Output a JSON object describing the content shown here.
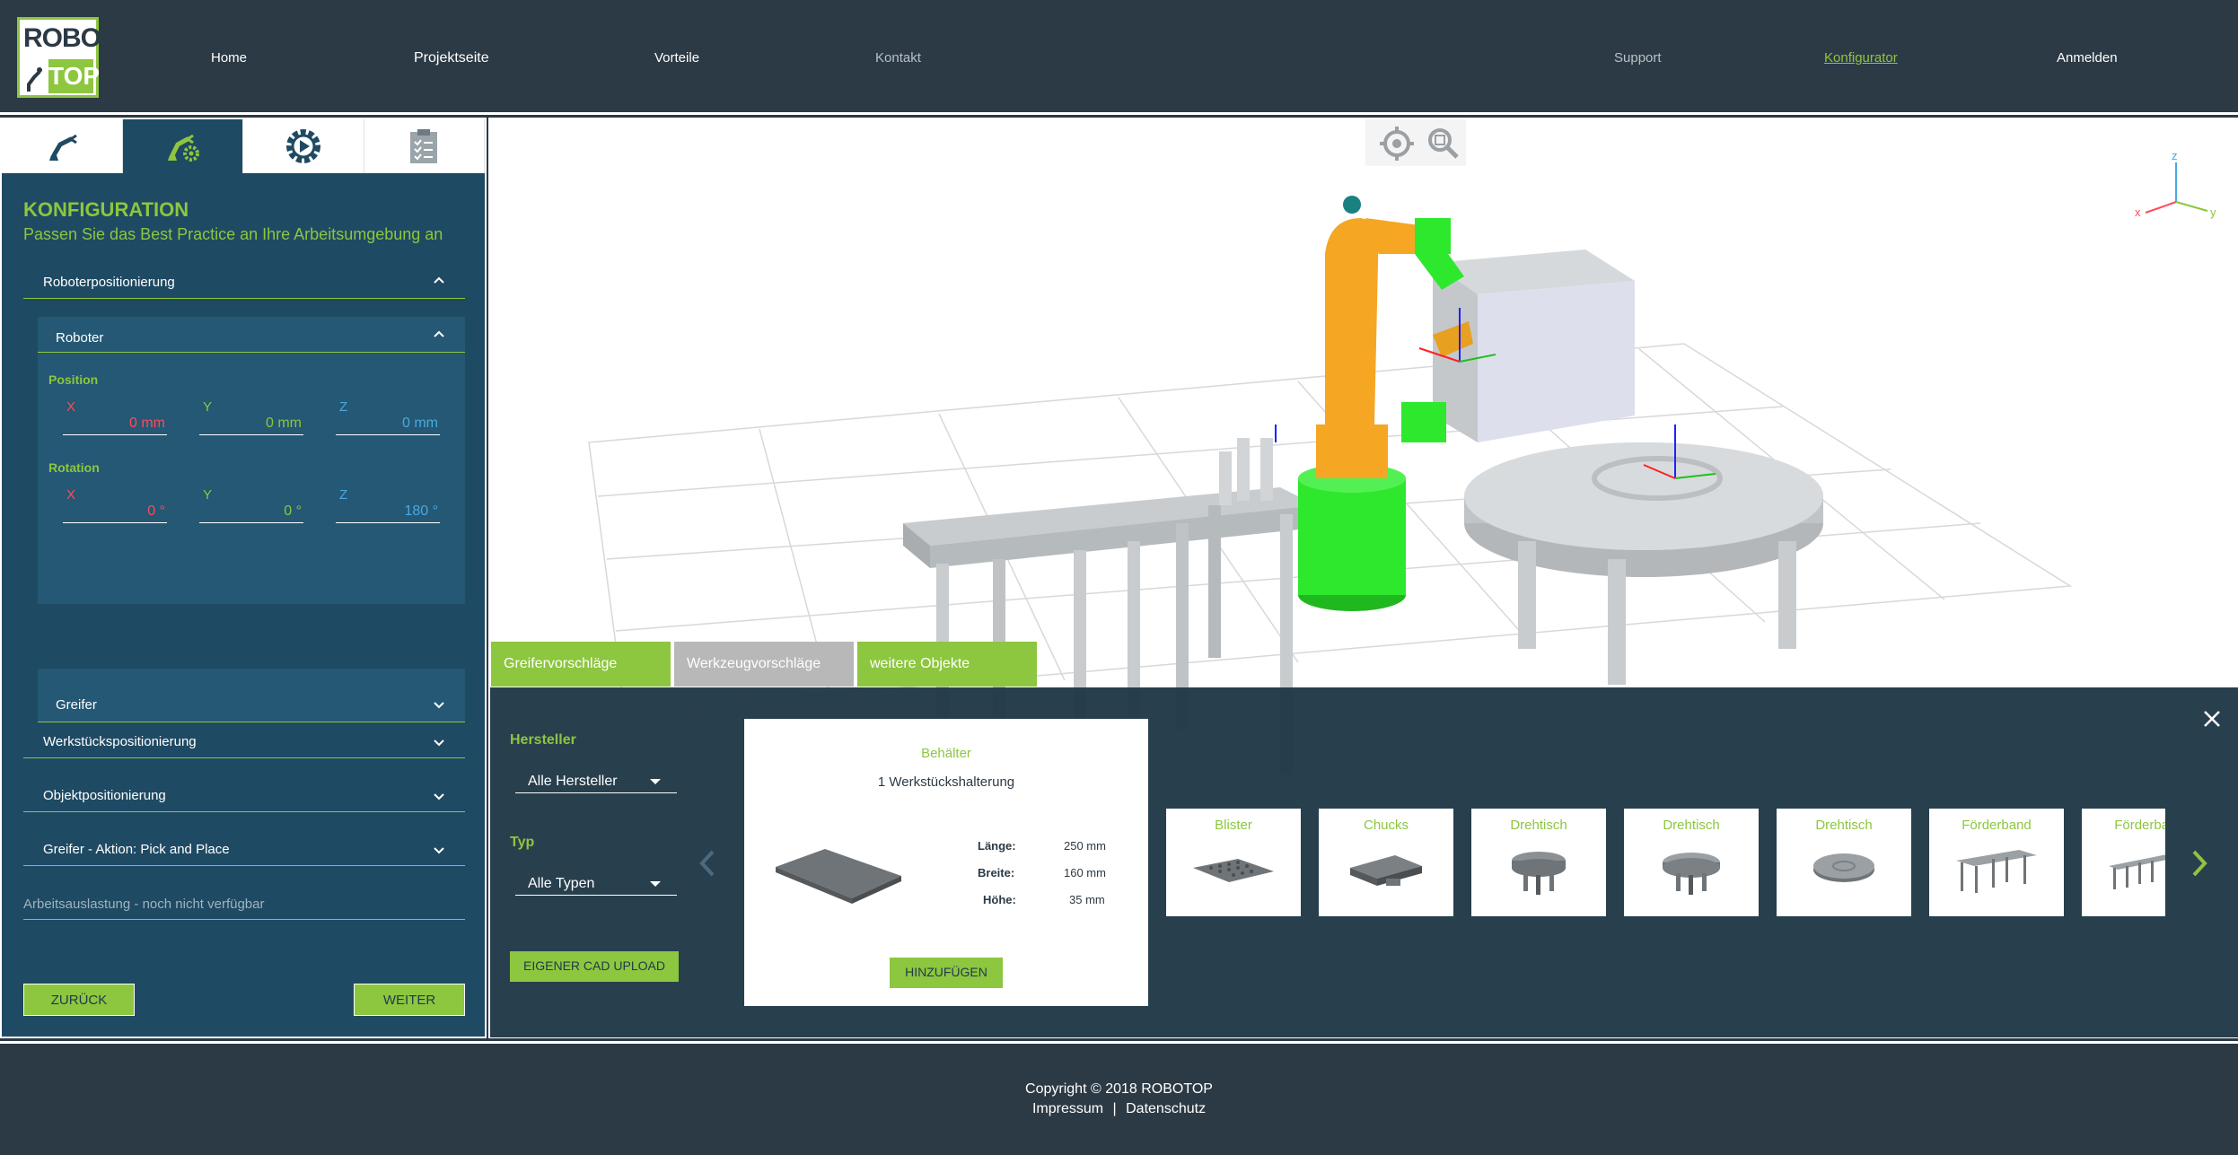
{
  "logo": {
    "line1": "ROBO",
    "line2": "TOP"
  },
  "nav": {
    "home": "Home",
    "projektseite": "Projektseite",
    "vorteile": "Vorteile",
    "kontakt": "Kontakt",
    "support": "Support",
    "konfigurator": "Konfigurator",
    "anmelden": "Anmelden"
  },
  "tabs": [
    {
      "icon": "robot-arm-icon",
      "active": false
    },
    {
      "icon": "robot-gear-icon",
      "active": true
    },
    {
      "icon": "gear-icon",
      "active": false
    },
    {
      "icon": "clipboard-icon",
      "active": false
    }
  ],
  "config": {
    "title": "KONFIGURATION",
    "subtitle": "Passen Sie das Best Practice an Ihre Arbeitsumgebung an",
    "roboterpositionierung": "Roboterpositionierung",
    "roboter": "Roboter",
    "position_label": "Position",
    "rotation_label": "Rotation",
    "position": {
      "x_label": "X",
      "y_label": "Y",
      "z_label": "Z",
      "x": "0 mm",
      "y": "0 mm",
      "z": "0 mm"
    },
    "rotation": {
      "x_label": "X",
      "y_label": "Y",
      "z_label": "Z",
      "x": "0 °",
      "y": "0 °",
      "z": "180 °"
    },
    "greifer": "Greifer",
    "werkstueck": "Werkstückspositionierung",
    "objekt": "Objektpositionierung",
    "aktion": "Greifer - Aktion: Pick and Place",
    "arbeit": "Arbeitsauslastung - noch nicht verfügbar",
    "back": "ZURÜCK",
    "next": "WEITER"
  },
  "suggestion_tabs": {
    "greifer": "Greifervorschläge",
    "werkzeug": "Werkzeugvorschläge",
    "weitere": "weitere Objekte"
  },
  "filters": {
    "hersteller_label": "Hersteller",
    "hersteller_value": "Alle Hersteller",
    "typ_label": "Typ",
    "typ_value": "Alle Typen",
    "upload": "EIGENER CAD UPLOAD"
  },
  "detail": {
    "title": "Behälter",
    "subtitle": "1 Werkstückshalterung",
    "laenge_label": "Länge:",
    "laenge": "250 mm",
    "breite_label": "Breite:",
    "breite": "160 mm",
    "hoehe_label": "Höhe:",
    "hoehe": "35 mm",
    "add": "HINZUFÜGEN"
  },
  "cards": [
    "Blister",
    "Chucks",
    "Drehtisch",
    "Drehtisch",
    "Drehtisch",
    "Förderband",
    "Förderband"
  ],
  "axes": {
    "x": "x",
    "y": "y",
    "z": "z"
  },
  "colors": {
    "accent": "#8dc63f",
    "panel": "#1f4a63",
    "header": "#2c3a45",
    "robot": "#f5a623",
    "base": "#2ee82e"
  },
  "footer": {
    "copyright": "Copyright © 2018 ROBOTOP",
    "impressum": "Impressum",
    "sep": "|",
    "datenschutz": "Datenschutz"
  }
}
